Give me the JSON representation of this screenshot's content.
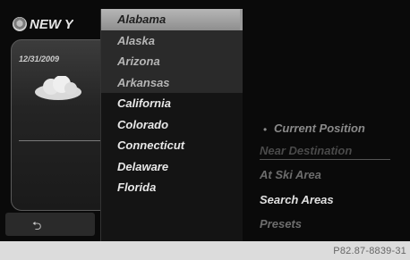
{
  "weather": {
    "city": "NEW Y",
    "date": "12/31/2009",
    "condition_icon": "cloud-icon",
    "back_icon": "back-arrow-icon",
    "back_glyph": "⮌"
  },
  "state_list": {
    "items": [
      {
        "label": "Alabama",
        "state": "selected"
      },
      {
        "label": "Alaska",
        "state": "dim"
      },
      {
        "label": "Arizona",
        "state": "dim"
      },
      {
        "label": "Arkansas",
        "state": "dim"
      },
      {
        "label": "California",
        "state": "normal"
      },
      {
        "label": "Colorado",
        "state": "normal"
      },
      {
        "label": "Connecticut",
        "state": "normal"
      },
      {
        "label": "Delaware",
        "state": "normal"
      },
      {
        "label": "Florida",
        "state": "normal"
      }
    ]
  },
  "menu": {
    "bullet": "•",
    "current_position": "Current Position",
    "near_destination": "Near Destination",
    "at_ski_area": "At Ski Area",
    "search_areas": "Search Areas",
    "presets": "Presets"
  },
  "footer": {
    "image_ref": "P82.87-8839-31"
  }
}
